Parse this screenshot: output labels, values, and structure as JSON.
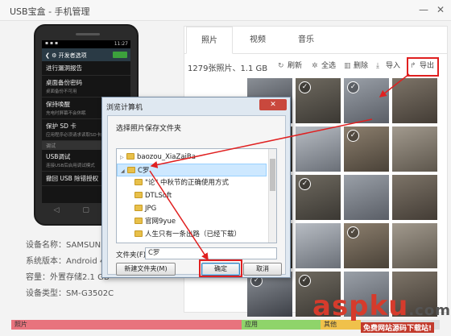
{
  "window": {
    "title": "USB宝盒 - 手机管理",
    "min": "—",
    "close": "✕"
  },
  "phone": {
    "status_time": "11:27",
    "status_left": "▪ ▪ ▪",
    "header": "开发者选项",
    "menu": [
      {
        "title": "进行漏洞报告",
        "sub": ""
      },
      {
        "title": "桌面备份密码",
        "sub": "桌面备份不可用"
      },
      {
        "title": "保持唤醒",
        "sub": "充电时屏幕不会休眠"
      },
      {
        "title": "保护 SD 卡",
        "sub": "应用程序必须请求读取SD卡的权限"
      }
    ],
    "section": "调试",
    "menu2": [
      {
        "title": "USB调试",
        "sub": "连接USB后启用调试模式"
      },
      {
        "title": "撤回 USB 除错授权",
        "sub": ""
      }
    ],
    "nav": [
      "◁",
      "▢",
      "≡"
    ]
  },
  "device_info": [
    {
      "label": "设备名称：SAMSUN"
    },
    {
      "label": "系统版本：Android 4"
    },
    {
      "label": "容量：外置存储2.1 GB"
    },
    {
      "label": "设备类型：SM-G3502C"
    }
  ],
  "tabs": [
    {
      "label": "照片",
      "active": true
    },
    {
      "label": "视频",
      "active": false
    },
    {
      "label": "音乐",
      "active": false
    }
  ],
  "toolbar": {
    "count": "1279张照片、1.1 GB",
    "refresh": "刷新",
    "select_all": "全选",
    "delete": "删除",
    "import": "导入",
    "export": "导出"
  },
  "dialog": {
    "title": "浏览计算机",
    "close": "✕",
    "prompt": "选择照片保存文件夹",
    "tree": [
      {
        "label": "baozou_XiaZaiBa",
        "level": 0,
        "selected": false,
        "arrow": "▷"
      },
      {
        "label": "C罗",
        "level": 0,
        "selected": true,
        "arrow": "◢"
      },
      {
        "label": "\"论\" 中秋节的正确使用方式",
        "level": 1,
        "selected": false,
        "arrow": ""
      },
      {
        "label": "DTLSoft",
        "level": 1,
        "selected": false,
        "arrow": ""
      },
      {
        "label": "JPG",
        "level": 1,
        "selected": false,
        "arrow": ""
      },
      {
        "label": "官网9yue",
        "level": 1,
        "selected": false,
        "arrow": ""
      },
      {
        "label": "人生只有一条出路（已经下载）",
        "level": 1,
        "selected": false,
        "arrow": ""
      }
    ],
    "folder_label": "文件夹(F):",
    "folder_value": "C罗",
    "new_folder": "新建文件夹(M)",
    "ok": "确定",
    "cancel": "取消"
  },
  "storage": [
    {
      "label": "照片",
      "color": "#e8737d"
    },
    {
      "label": "应用",
      "color": "#8fd46a"
    },
    {
      "label": "其他",
      "color": "#f0c14b"
    }
  ],
  "watermark": {
    "main": "aspku",
    "tld": ".com",
    "sub": "免费网站源码下载站!"
  },
  "colors": {
    "highlight": "#e02020",
    "accent": "#3ca13c"
  }
}
